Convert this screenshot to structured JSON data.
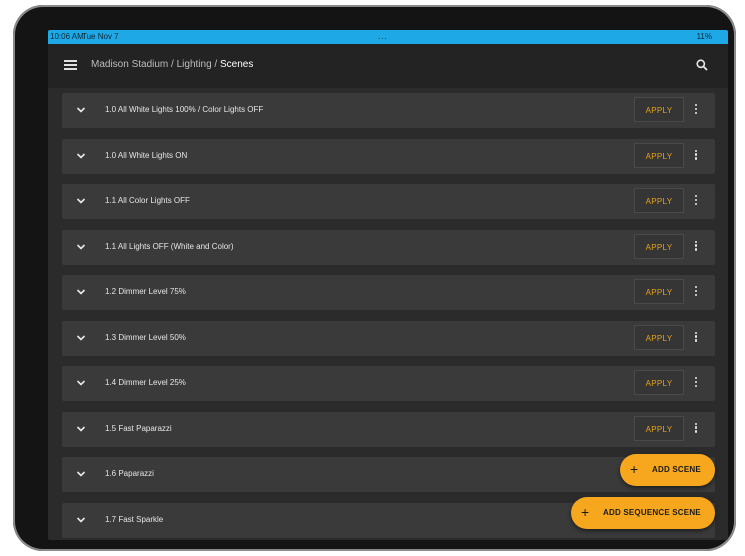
{
  "status_bar": {
    "time": "10:06 AM",
    "date": "Tue Nov 7",
    "dots": "...",
    "battery": "11%"
  },
  "header": {
    "breadcrumb_root": "Madison Stadium",
    "separator": " / ",
    "breadcrumb_mid": "Lighting",
    "breadcrumb_current": "Scenes",
    "menu_icon": "hamburger-menu-icon",
    "search_icon": "search-icon"
  },
  "colors": {
    "status_bar": "#1fa8e6",
    "accent": "#f6a71d",
    "apply_text": "#e5a21b",
    "row_bg": "#3a3a3a",
    "app_bg": "#2b2b2b"
  },
  "scenes": [
    {
      "label": "1.0 All White Lights 100% / Color Lights OFF",
      "apply": "APPLY"
    },
    {
      "label": "1.0 All White Lights ON",
      "apply": "APPLY"
    },
    {
      "label": "1.1 All Color Lights OFF",
      "apply": "APPLY"
    },
    {
      "label": "1.1 All Lights OFF (White and Color)",
      "apply": "APPLY"
    },
    {
      "label": "1.2 Dimmer Level 75%",
      "apply": "APPLY"
    },
    {
      "label": "1.3 Dimmer Level 50%",
      "apply": "APPLY"
    },
    {
      "label": "1.4 Dimmer Level 25%",
      "apply": "APPLY"
    },
    {
      "label": "1.5 Fast Paparazzi",
      "apply": "APPLY"
    },
    {
      "label": "1.6 Paparazzi",
      "apply": ""
    },
    {
      "label": "1.7 Fast Sparkle",
      "apply": ""
    }
  ],
  "actions": {
    "add_scene": "ADD SCENE",
    "add_sequence_scene": "ADD SEQUENCE SCENE"
  }
}
